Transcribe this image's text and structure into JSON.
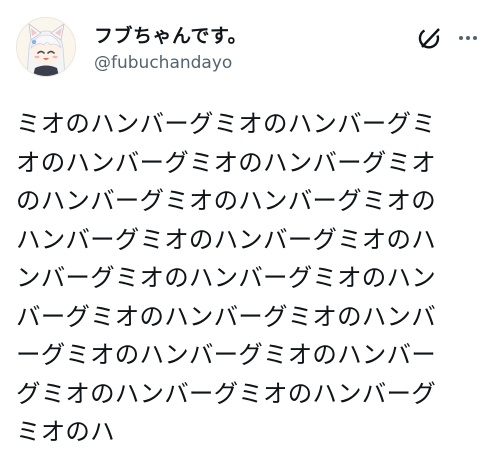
{
  "author": {
    "display_name": "フブちゃんです。",
    "handle": "@fubuchandayo",
    "avatar_icon": "fox-girl-avatar-icon"
  },
  "actions": {
    "grok_icon": "grok-icon",
    "more_icon": "more-horizontal-icon"
  },
  "tweet": {
    "text": "ミオのハンバーグミオのハンバーグミ\nオのハンバーグミオのハンバーグミオ\nのハンバーグミオのハンバーグミオの\nハンバーグミオのハンバーグミオのハ\nンバーグミオのハンバーグミオのハン\nバーグミオのハンバーグミオのハンバ\nーグミオのハンバーグミオのハンバー\nグミオのハンバーグミオのハンバーグ\nミオのハ"
  },
  "colors": {
    "text_primary": "#0f1419",
    "text_secondary": "#536471",
    "background": "#ffffff"
  }
}
